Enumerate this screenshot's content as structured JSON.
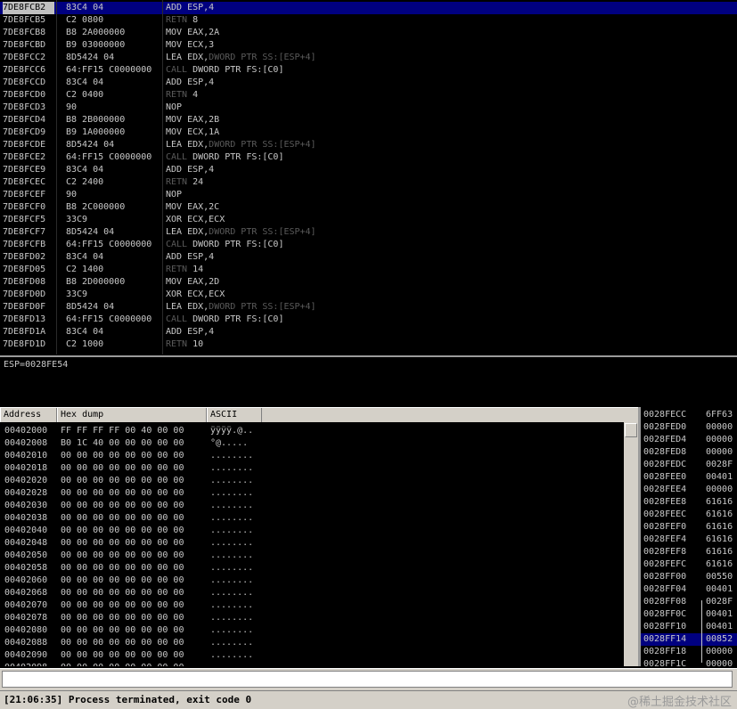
{
  "disassembly": {
    "rows": [
      {
        "addr": "7DE8FCB2",
        "hex": "83C4 04",
        "pre": "ADD",
        "pdim": false,
        "ops": " ESP,4",
        "sys": "",
        "tail": ""
      },
      {
        "addr": "7DE8FCB5",
        "hex": "C2 0800",
        "pre": "RETN",
        "pdim": true,
        "ops": " 8",
        "sys": "",
        "tail": ""
      },
      {
        "addr": "7DE8FCB8",
        "hex": "B8 2A000000",
        "pre": "MOV",
        "pdim": false,
        "ops": " EAX,2A",
        "sys": "",
        "tail": ""
      },
      {
        "addr": "7DE8FCBD",
        "hex": "B9 03000000",
        "pre": "MOV",
        "pdim": false,
        "ops": " ECX,3",
        "sys": "",
        "tail": ""
      },
      {
        "addr": "7DE8FCC2",
        "hex": "8D5424 04",
        "pre": "LEA",
        "pdim": false,
        "ops": " EDX,",
        "sys": "DWORD PTR SS:[ESP+4]",
        "tail": ""
      },
      {
        "addr": "7DE8FCC6",
        "hex": "64:FF15 C0000000",
        "pre": "CALL",
        "pdim": true,
        "ops": " DWORD PTR FS:[C0]",
        "sys": "",
        "tail": ""
      },
      {
        "addr": "7DE8FCCD",
        "hex": "83C4 04",
        "pre": "ADD",
        "pdim": false,
        "ops": " ESP,4",
        "sys": "",
        "tail": ""
      },
      {
        "addr": "7DE8FCD0",
        "hex": "C2 0400",
        "pre": "RETN",
        "pdim": true,
        "ops": " 4",
        "sys": "",
        "tail": ""
      },
      {
        "addr": "7DE8FCD3",
        "hex": "90",
        "pre": "NOP",
        "pdim": false,
        "ops": "",
        "sys": "",
        "tail": ""
      },
      {
        "addr": "7DE8FCD4",
        "hex": "B8 2B000000",
        "pre": "MOV",
        "pdim": false,
        "ops": " EAX,2B",
        "sys": "",
        "tail": ""
      },
      {
        "addr": "7DE8FCD9",
        "hex": "B9 1A000000",
        "pre": "MOV",
        "pdim": false,
        "ops": " ECX,1A",
        "sys": "",
        "tail": ""
      },
      {
        "addr": "7DE8FCDE",
        "hex": "8D5424 04",
        "pre": "LEA",
        "pdim": false,
        "ops": " EDX,",
        "sys": "DWORD PTR SS:[ESP+4]",
        "tail": ""
      },
      {
        "addr": "7DE8FCE2",
        "hex": "64:FF15 C0000000",
        "pre": "CALL",
        "pdim": true,
        "ops": " DWORD PTR FS:[C0]",
        "sys": "",
        "tail": ""
      },
      {
        "addr": "7DE8FCE9",
        "hex": "83C4 04",
        "pre": "ADD",
        "pdim": false,
        "ops": " ESP,4",
        "sys": "",
        "tail": ""
      },
      {
        "addr": "7DE8FCEC",
        "hex": "C2 2400",
        "pre": "RETN",
        "pdim": true,
        "ops": " 24",
        "sys": "",
        "tail": ""
      },
      {
        "addr": "7DE8FCEF",
        "hex": "90",
        "pre": "NOP",
        "pdim": false,
        "ops": "",
        "sys": "",
        "tail": ""
      },
      {
        "addr": "7DE8FCF0",
        "hex": "B8 2C000000",
        "pre": "MOV",
        "pdim": false,
        "ops": " EAX,2C",
        "sys": "",
        "tail": ""
      },
      {
        "addr": "7DE8FCF5",
        "hex": "33C9",
        "pre": "XOR",
        "pdim": false,
        "ops": " ECX,ECX",
        "sys": "",
        "tail": ""
      },
      {
        "addr": "7DE8FCF7",
        "hex": "8D5424 04",
        "pre": "LEA",
        "pdim": false,
        "ops": " EDX,",
        "sys": "DWORD PTR SS:[ESP+4]",
        "tail": ""
      },
      {
        "addr": "7DE8FCFB",
        "hex": "64:FF15 C0000000",
        "pre": "CALL",
        "pdim": true,
        "ops": " DWORD PTR FS:[C0]",
        "sys": "",
        "tail": ""
      },
      {
        "addr": "7DE8FD02",
        "hex": "83C4 04",
        "pre": "ADD",
        "pdim": false,
        "ops": " ESP,4",
        "sys": "",
        "tail": ""
      },
      {
        "addr": "7DE8FD05",
        "hex": "C2 1400",
        "pre": "RETN",
        "pdim": true,
        "ops": " 14",
        "sys": "",
        "tail": ""
      },
      {
        "addr": "7DE8FD08",
        "hex": "B8 2D000000",
        "pre": "MOV",
        "pdim": false,
        "ops": " EAX,2D",
        "sys": "",
        "tail": ""
      },
      {
        "addr": "7DE8FD0D",
        "hex": "33C9",
        "pre": "XOR",
        "pdim": false,
        "ops": " ECX,ECX",
        "sys": "",
        "tail": ""
      },
      {
        "addr": "7DE8FD0F",
        "hex": "8D5424 04",
        "pre": "LEA",
        "pdim": false,
        "ops": " EDX,",
        "sys": "DWORD PTR SS:[ESP+4]",
        "tail": ""
      },
      {
        "addr": "7DE8FD13",
        "hex": "64:FF15 C0000000",
        "pre": "CALL",
        "pdim": true,
        "ops": " DWORD PTR FS:[C0]",
        "sys": "",
        "tail": ""
      },
      {
        "addr": "7DE8FD1A",
        "hex": "83C4 04",
        "pre": "ADD",
        "pdim": false,
        "ops": " ESP,4",
        "sys": "",
        "tail": ""
      },
      {
        "addr": "7DE8FD1D",
        "hex": "C2 1000",
        "pre": "RETN",
        "pdim": true,
        "ops": " 10",
        "sys": "",
        "tail": ""
      }
    ]
  },
  "info": {
    "text": "ESP=0028FE54"
  },
  "dump": {
    "headers": {
      "address": "Address",
      "hex": "Hex dump",
      "ascii": "ASCII"
    },
    "rows": [
      {
        "addr": "00402000",
        "hex": "FF FF FF FF 00 40 00 00",
        "ascii": "ÿÿÿÿ.@.."
      },
      {
        "addr": "00402008",
        "hex": "B0 1C 40 00 00 00 00 00",
        "ascii": "°@....."
      },
      {
        "addr": "00402010",
        "hex": "00 00 00 00 00 00 00 00",
        "ascii": "........"
      },
      {
        "addr": "00402018",
        "hex": "00 00 00 00 00 00 00 00",
        "ascii": "........"
      },
      {
        "addr": "00402020",
        "hex": "00 00 00 00 00 00 00 00",
        "ascii": "........"
      },
      {
        "addr": "00402028",
        "hex": "00 00 00 00 00 00 00 00",
        "ascii": "........"
      },
      {
        "addr": "00402030",
        "hex": "00 00 00 00 00 00 00 00",
        "ascii": "........"
      },
      {
        "addr": "00402038",
        "hex": "00 00 00 00 00 00 00 00",
        "ascii": "........"
      },
      {
        "addr": "00402040",
        "hex": "00 00 00 00 00 00 00 00",
        "ascii": "........"
      },
      {
        "addr": "00402048",
        "hex": "00 00 00 00 00 00 00 00",
        "ascii": "........"
      },
      {
        "addr": "00402050",
        "hex": "00 00 00 00 00 00 00 00",
        "ascii": "........"
      },
      {
        "addr": "00402058",
        "hex": "00 00 00 00 00 00 00 00",
        "ascii": "........"
      },
      {
        "addr": "00402060",
        "hex": "00 00 00 00 00 00 00 00",
        "ascii": "........"
      },
      {
        "addr": "00402068",
        "hex": "00 00 00 00 00 00 00 00",
        "ascii": "........"
      },
      {
        "addr": "00402070",
        "hex": "00 00 00 00 00 00 00 00",
        "ascii": "........"
      },
      {
        "addr": "00402078",
        "hex": "00 00 00 00 00 00 00 00",
        "ascii": "........"
      },
      {
        "addr": "00402080",
        "hex": "00 00 00 00 00 00 00 00",
        "ascii": "........"
      },
      {
        "addr": "00402088",
        "hex": "00 00 00 00 00 00 00 00",
        "ascii": "........"
      },
      {
        "addr": "00402090",
        "hex": "00 00 00 00 00 00 00 00",
        "ascii": "........"
      },
      {
        "addr": "00402098",
        "hex": "00 00 00 00 00 00 00 00",
        "ascii": "........"
      }
    ]
  },
  "stack": {
    "rows": [
      {
        "addr": "0028FECC",
        "val": "6FF63"
      },
      {
        "addr": "0028FED0",
        "val": "00000"
      },
      {
        "addr": "0028FED4",
        "val": "00000"
      },
      {
        "addr": "0028FED8",
        "val": "00000"
      },
      {
        "addr": "0028FEDC",
        "val": "0028F"
      },
      {
        "addr": "0028FEE0",
        "val": "00401"
      },
      {
        "addr": "0028FEE4",
        "val": "00000"
      },
      {
        "addr": "0028FEE8",
        "val": "61616"
      },
      {
        "addr": "0028FEEC",
        "val": "61616"
      },
      {
        "addr": "0028FEF0",
        "val": "61616"
      },
      {
        "addr": "0028FEF4",
        "val": "61616"
      },
      {
        "addr": "0028FEF8",
        "val": "61616"
      },
      {
        "addr": "0028FEFC",
        "val": "61616"
      },
      {
        "addr": "0028FF00",
        "val": "00550"
      },
      {
        "addr": "0028FF04",
        "val": "00401"
      },
      {
        "addr": "0028FF08",
        "val": "0028F"
      },
      {
        "addr": "0028FF0C",
        "val": "00401"
      },
      {
        "addr": "0028FF10",
        "val": "00401"
      },
      {
        "addr": "0028FF14",
        "val": "00852"
      },
      {
        "addr": "0028FF18",
        "val": "00000"
      },
      {
        "addr": "0028FF1C",
        "val": "00000"
      }
    ]
  },
  "status": {
    "message": "[21:06:35] Process terminated, exit code 0",
    "watermark": "@稀土掘金技术社区"
  },
  "colors": {
    "selection": "#000080",
    "text": "#c8c8c8",
    "dim": "#5a5a5a",
    "panel": "#d4d0c8"
  }
}
